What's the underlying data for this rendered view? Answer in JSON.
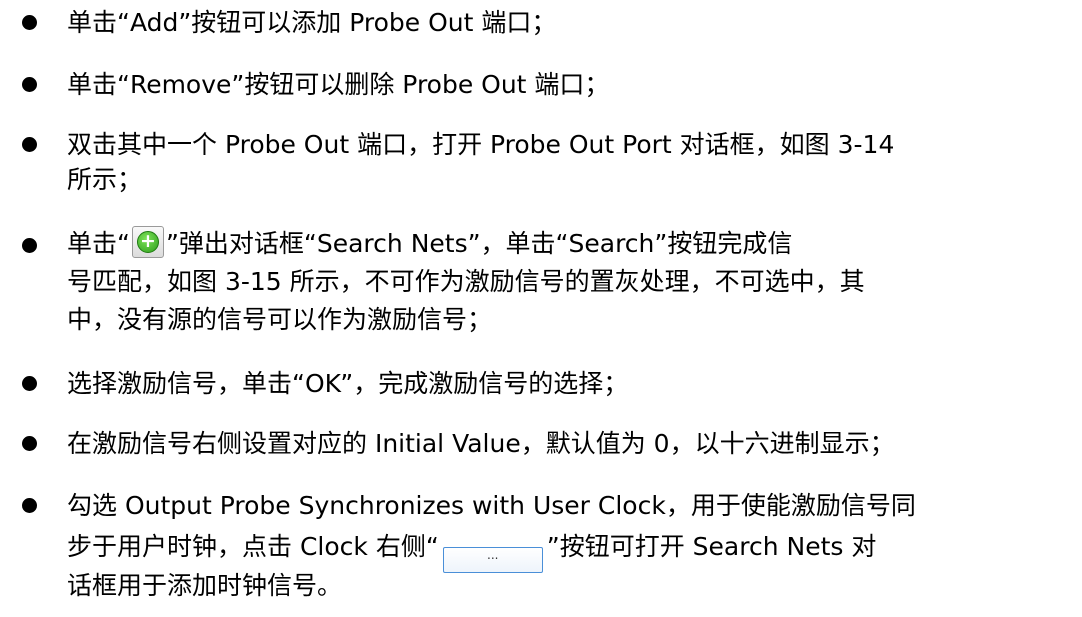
{
  "items": [
    {
      "lines": [
        "单击“Add”按钮可以添加 Probe Out 端口；"
      ]
    },
    {
      "lines": [
        "单击“Remove”按钮可以删除 Probe Out 端口；"
      ]
    },
    {
      "lines": [
        "双击其中一个 Probe Out 端口，打开 Probe Out Port 对话框，如图 3-14",
        "所示；"
      ]
    },
    {
      "lines_parts": {
        "line1_before": "单击“",
        "line1_after": "”弹出对话框“Search Nets”，单击“Search”按钮完成信",
        "line2": "号匹配，如图 3-15 所示，不可作为激励信号的置灰处理，不可选中，其",
        "line3": "中，没有源的信号可以作为激励信号；",
        "icon_glyph": "+"
      }
    },
    {
      "lines": [
        "选择激励信号，单击“OK”，完成激励信号的选择；"
      ]
    },
    {
      "lines": [
        "在激励信号右侧设置对应的 Initial Value，默认值为 0，以十六进制显示；"
      ]
    },
    {
      "lines_parts": {
        "line1": "勾选 Output Probe Synchronizes with User Clock，用于使能激励信号同",
        "line2_before": "步于用户时钟，点击 Clock 右侧“",
        "line2_after": "”按钮可打开 Search Nets 对",
        "line3": "话框用于添加时钟信号。",
        "button_glyph": "..."
      }
    }
  ],
  "colors": {
    "text": "#000000",
    "background": "#ffffff",
    "button_border": "#4a8fd8",
    "icon_green": "#2e9e1c"
  }
}
